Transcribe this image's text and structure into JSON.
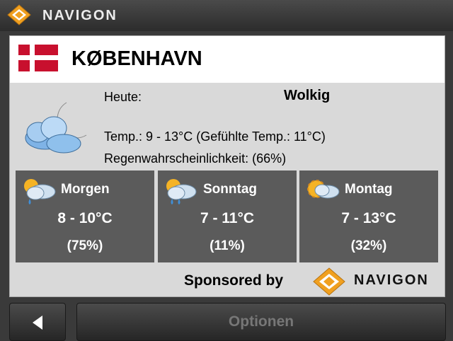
{
  "topbar": {
    "brand": "NAVIGON"
  },
  "header": {
    "city": "KØBENHAVN",
    "flag_icon": "denmark-flag"
  },
  "today": {
    "label": "Heute:",
    "condition": "Wolkig",
    "temp": "Temp.: 9 - 13°C (Gefühlte Temp.: 11°C)",
    "rain": "Regenwahrscheinlichkeit: (66%)",
    "icon": "cloudy-night-icon"
  },
  "forecast": [
    {
      "day": "Morgen",
      "range": "8 - 10°C",
      "pct": "(75%)",
      "icon": "sun-cloud-rain-icon"
    },
    {
      "day": "Sonntag",
      "range": "7 - 11°C",
      "pct": "(11%)",
      "icon": "sun-cloud-rain-icon"
    },
    {
      "day": "Montag",
      "range": "7 - 13°C",
      "pct": "(32%)",
      "icon": "sun-cloud-icon"
    }
  ],
  "sponsor": {
    "text": "Sponsored by",
    "brand": "NAVIGON"
  },
  "bottom": {
    "options_label": "Optionen"
  },
  "colors": {
    "panel_bg": "#d9d9d9",
    "forecast_bg": "#5b5b5b",
    "brand_orange": "#f0a020",
    "flag_red": "#c8102e"
  }
}
